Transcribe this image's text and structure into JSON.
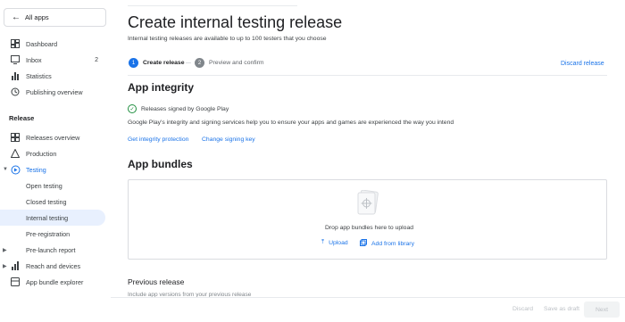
{
  "sidebar": {
    "all_apps": "All apps",
    "items": [
      {
        "label": "Dashboard"
      },
      {
        "label": "Inbox",
        "count": "2"
      },
      {
        "label": "Statistics"
      },
      {
        "label": "Publishing overview"
      }
    ],
    "section_release": "Release",
    "release_items": [
      {
        "label": "Releases overview"
      },
      {
        "label": "Production"
      },
      {
        "label": "Testing"
      },
      {
        "label": "Open testing"
      },
      {
        "label": "Closed testing"
      },
      {
        "label": "Internal testing"
      },
      {
        "label": "Pre-registration"
      },
      {
        "label": "Pre-launch report"
      },
      {
        "label": "Reach and devices"
      },
      {
        "label": "App bundle explorer"
      }
    ]
  },
  "header": {
    "title": "Create internal testing release",
    "subtitle": "Internal testing releases are available to up to 100 testers that you choose"
  },
  "steps": [
    {
      "num": "1",
      "label": "Create release"
    },
    {
      "num": "2",
      "label": "Preview and confirm"
    }
  ],
  "discard_release": "Discard release",
  "integrity": {
    "title": "App integrity",
    "signed": "Releases signed by Google Play",
    "text": "Google Play's integrity and signing services help you to ensure your apps and games are experienced the way you intend",
    "link1": "Get integrity protection",
    "link2": "Change signing key"
  },
  "bundles": {
    "title": "App bundles",
    "drop_text": "Drop app bundles here to upload",
    "upload": "Upload",
    "library": "Add from library"
  },
  "previous": {
    "title": "Previous release",
    "sub": "Include app versions from your previous release"
  },
  "footer": {
    "discard": "Discard",
    "save_draft": "Save as draft",
    "next": "Next"
  }
}
